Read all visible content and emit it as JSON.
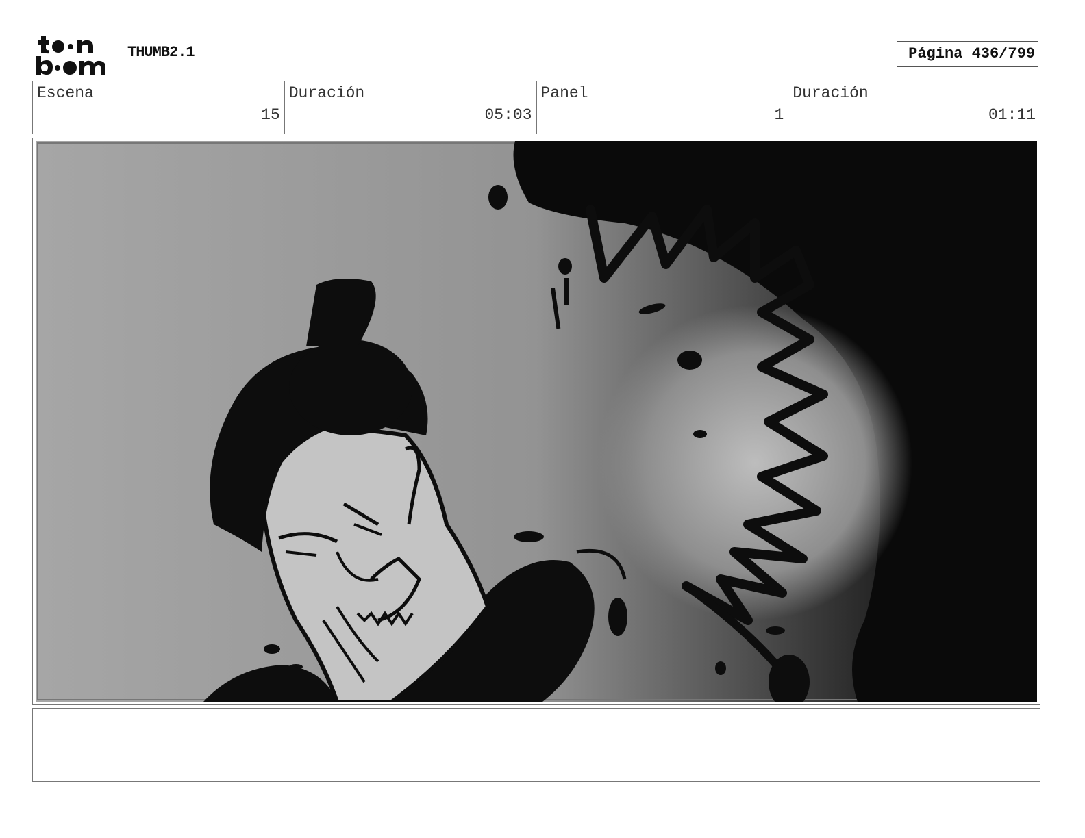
{
  "header": {
    "logo_top": "toon",
    "logo_bottom": "boom",
    "title": "THUMB2.1",
    "page": "Página 436/799"
  },
  "info": [
    {
      "label": "Escena",
      "value": "15"
    },
    {
      "label": "Duración",
      "value": "05:03"
    },
    {
      "label": "Panel",
      "value": "1"
    },
    {
      "label": "Duración",
      "value": "01:11"
    }
  ],
  "panel": {
    "image": "storyboard-sketch-samurai-and-giant-mouth"
  },
  "notes": {
    "text": ""
  }
}
